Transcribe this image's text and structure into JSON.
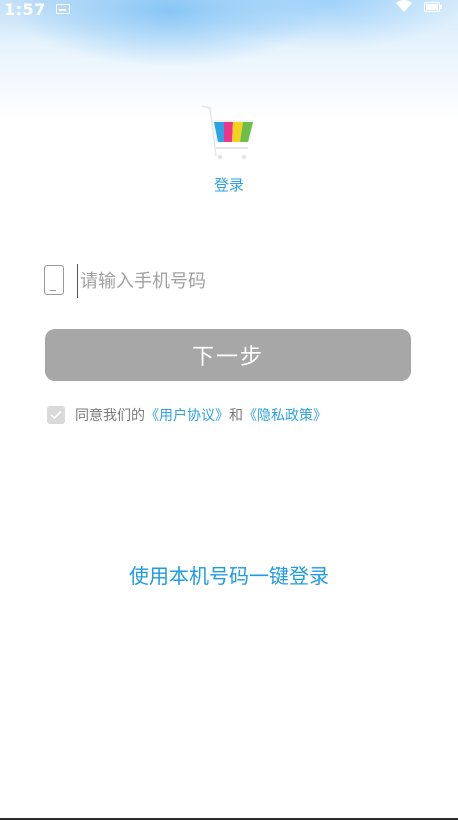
{
  "status_bar": {
    "time": "1:57"
  },
  "header": {
    "login_label": "登录"
  },
  "form": {
    "phone_placeholder": "请输入手机号码",
    "phone_value": "",
    "next_label": "下一步"
  },
  "agreement": {
    "prefix": "同意我们的",
    "user_agreement": "《用户协议》",
    "and": "和",
    "privacy_policy": "《隐私政策》",
    "checked": true
  },
  "one_key_login": "使用本机号码一键登录",
  "colors": {
    "accent": "#2ea3e0",
    "button_disabled": "#a7a7a7",
    "text_muted": "#7a7a7a"
  }
}
